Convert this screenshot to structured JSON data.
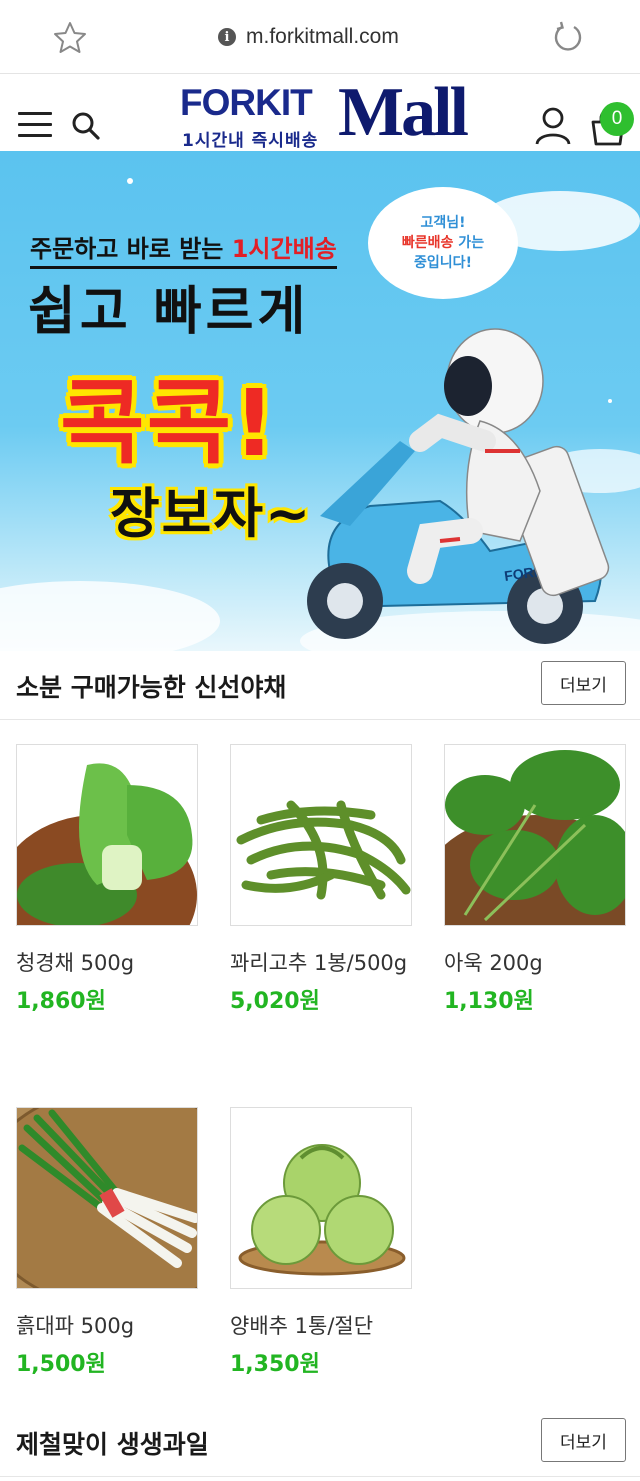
{
  "browser": {
    "url": "m.forkitmall.com"
  },
  "header": {
    "logo_top": "FORKIT",
    "logo_mall": "Mall",
    "logo_sub": "1시간내 즉시배송",
    "cart_count": "0"
  },
  "banner": {
    "line1_pre": "주문하고 바로 받는 ",
    "line1_hl": "1시간배송",
    "line2": "쉽고 빠르게",
    "line3": "콕콕!",
    "line4": "장보자~",
    "bubble_1": "고객님!",
    "bubble_2a": "빠른배송",
    "bubble_2b": " 가는",
    "bubble_3": "중입니다!",
    "scooter_brand": "FORKIT MALL"
  },
  "section_veg": {
    "title": "소분 구매가능한 신선야채",
    "more": "더보기"
  },
  "products": [
    {
      "name": "청경채 500g",
      "price": "1,860원"
    },
    {
      "name": "꽈리고추 1봉/500g",
      "price": "5,020원"
    },
    {
      "name": "아욱 200g",
      "price": "1,130원"
    },
    {
      "name": "흙대파 500g",
      "price": "1,500원"
    },
    {
      "name": "양배추 1통/절단",
      "price": "1,350원"
    }
  ],
  "section_fruit": {
    "title": "제철맞이 생생과일",
    "more": "더보기"
  },
  "colors": {
    "brand": "#1a2a8c",
    "price": "#22b522",
    "badge": "#2fbf2f"
  }
}
